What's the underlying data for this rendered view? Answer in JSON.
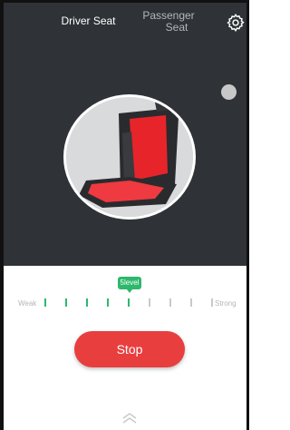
{
  "tabs": {
    "driver": "Driver Seat",
    "passenger_line1": "Passenger",
    "passenger_line2": "Seat",
    "active": "driver"
  },
  "icons": {
    "settings": "gear-icon",
    "link": "link-icon",
    "expand": "chevron-up-icon",
    "toggle": "toggle-dot"
  },
  "intensity": {
    "level_label": "5level",
    "left_label": "Weak",
    "right_label": "Strong",
    "level": 5,
    "max": 8
  },
  "action": {
    "stop_label": "Stop"
  },
  "colors": {
    "panel_bg": "#2f3337",
    "accent_green": "#2db86b",
    "stop_red": "#e83e3e",
    "seat_red": "#e8242b"
  }
}
